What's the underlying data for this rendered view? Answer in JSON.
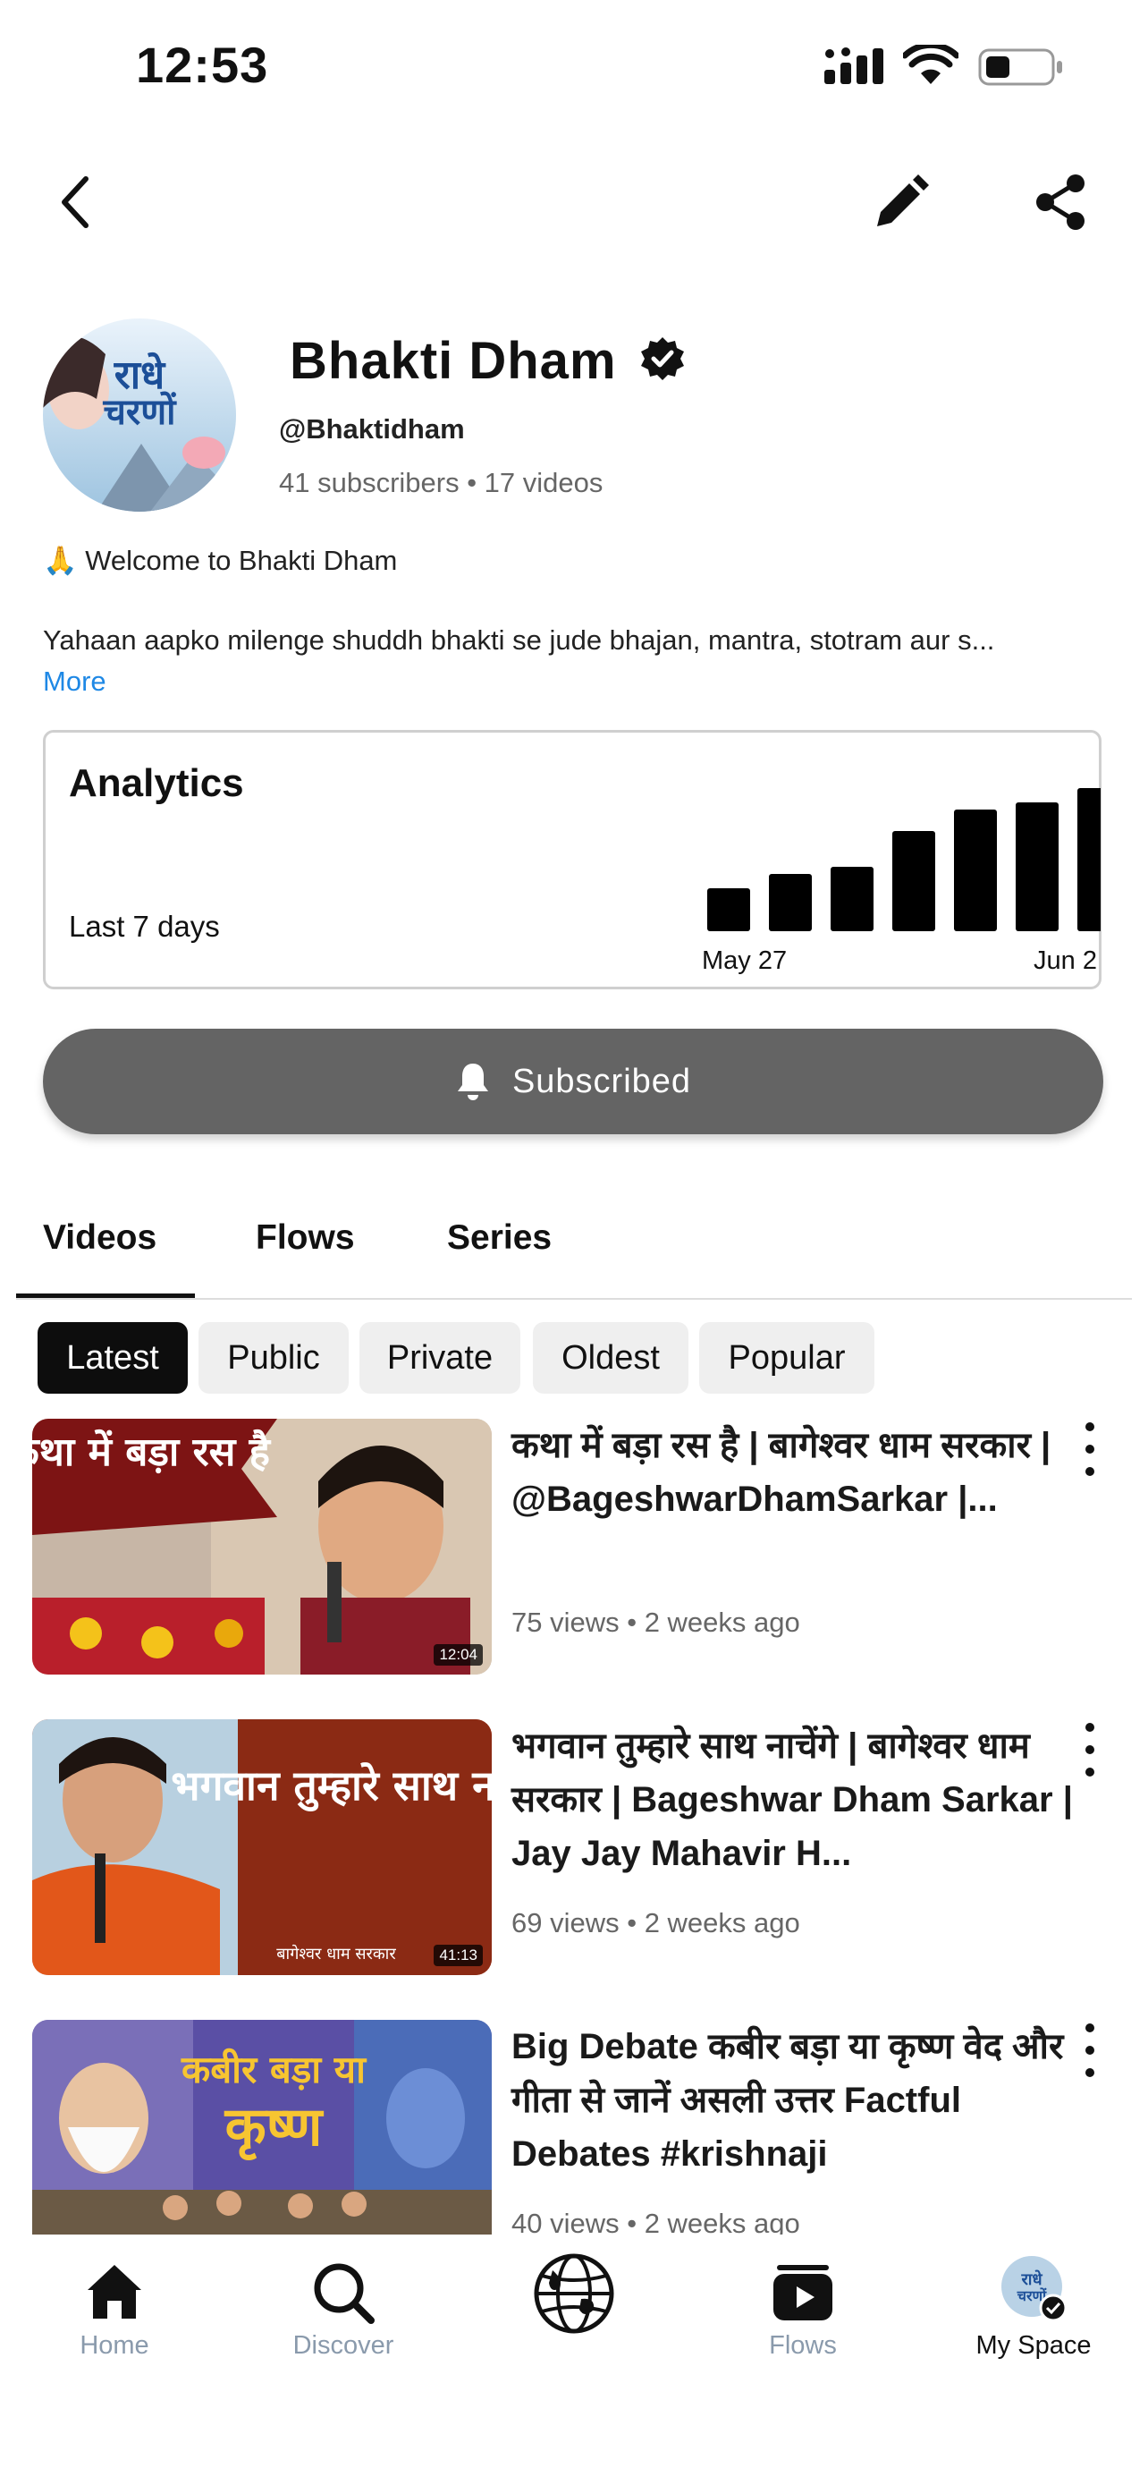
{
  "status_bar": {
    "time": "12:53"
  },
  "header": {
    "back_icon": "chevron-left-icon",
    "edit_icon": "pencil-icon",
    "share_icon": "share-icon"
  },
  "channel": {
    "name": "Bhakti Dham",
    "verified_icon": "verified-badge-icon",
    "handle": "@Bhaktidham",
    "stats": "41 subscribers • 17 videos",
    "welcome": "🙏 Welcome to Bhakti Dham",
    "description": "Yahaan aapko milenge shuddh bhakti se jude bhajan, mantra, stotram aur s...",
    "more_label": "More"
  },
  "analytics": {
    "title": "Analytics",
    "period": "Last 7 days"
  },
  "chart_data": {
    "type": "bar",
    "categories": [
      "May 27",
      "",
      "",
      "",
      "",
      "",
      "Jun 2"
    ],
    "values": [
      3,
      4,
      4.5,
      7,
      8.5,
      9,
      10
    ],
    "color": "#000000"
  },
  "subscribe": {
    "label": "Subscribed",
    "icon": "bell-icon"
  },
  "tabs": [
    {
      "label": "Videos",
      "active": true
    },
    {
      "label": "Flows",
      "active": false
    },
    {
      "label": "Series",
      "active": false
    }
  ],
  "filters": [
    {
      "label": "Latest",
      "active": true
    },
    {
      "label": "Public",
      "active": false
    },
    {
      "label": "Private",
      "active": false
    },
    {
      "label": "Oldest",
      "active": false
    },
    {
      "label": "Popular",
      "active": false
    }
  ],
  "videos": [
    {
      "title": "कथा में बड़ा रस है | बागेश्वर धाम सरकार | @BageshwarDhamSarkar |...",
      "meta": "75 views • 2 weeks ago",
      "duration": "12:04",
      "thumb_text": "कथा में बड़ा रस है"
    },
    {
      "title": "भगवान तुम्हारे साथ नाचेंगे | बागेश्वर धाम सरकार | Bageshwar Dham Sarkar | Jay Jay Mahavir H...",
      "meta": "69 views • 2 weeks ago",
      "duration": "41:13",
      "thumb_text": "भगवान तुम्हारे साथ नाचेंगे",
      "thumb_caption": "बागेश्वर धाम सरकार"
    },
    {
      "title": "Big Debate कबीर बड़ा या कृष्ण वेद और गीता से जानें असली उत्तर Factful Debates  #krishnaji",
      "meta": "40 views • 2 weeks ago",
      "thumb_text_1": "कबीर बड़ा या",
      "thumb_text_2": "कृष्ण"
    }
  ],
  "bottom_nav": [
    {
      "label": "Home",
      "icon": "home-icon"
    },
    {
      "label": "Discover",
      "icon": "search-icon"
    },
    {
      "label": "",
      "icon": "globe-icon"
    },
    {
      "label": "Flows",
      "icon": "flows-play-icon"
    },
    {
      "label": "My Space",
      "icon": "avatar-icon"
    }
  ]
}
